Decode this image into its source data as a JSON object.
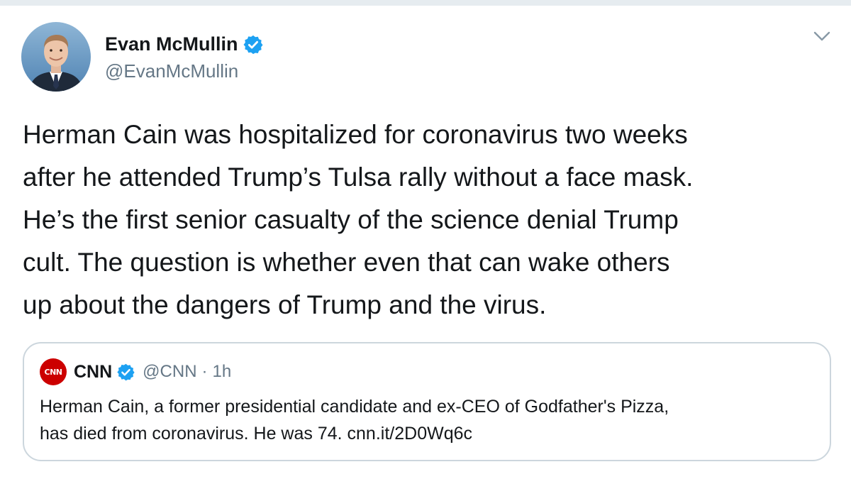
{
  "author": {
    "display_name": "Evan McMullin",
    "handle": "@EvanMcMullin",
    "verified": true,
    "avatar_icon": "avatar-photo-icon"
  },
  "menu": {
    "icon": "chevron-down-icon"
  },
  "tweet": {
    "text": "Herman Cain was hospitalized for coronavirus two weeks\nafter he attended Trump’s Tulsa rally without a face mask.\nHe’s the first senior casualty of the science denial Trump\ncult. The question is whether even that can wake others\nup about the dangers of Trump and the virus."
  },
  "quote": {
    "logo_text": "CNN",
    "display_name": "CNN",
    "verified": true,
    "handle": "@CNN",
    "separator": "·",
    "time": "1h",
    "text": "Herman Cain, a former presidential candidate and ex-CEO of Godfather's Pizza,\nhas died from coronavirus. He was 74. cnn.it/2D0Wq6c"
  },
  "colors": {
    "verified_blue": "#1da1f2",
    "muted_text": "#657786",
    "border": "#ccd6dd",
    "cnn_red": "#cc0000"
  }
}
